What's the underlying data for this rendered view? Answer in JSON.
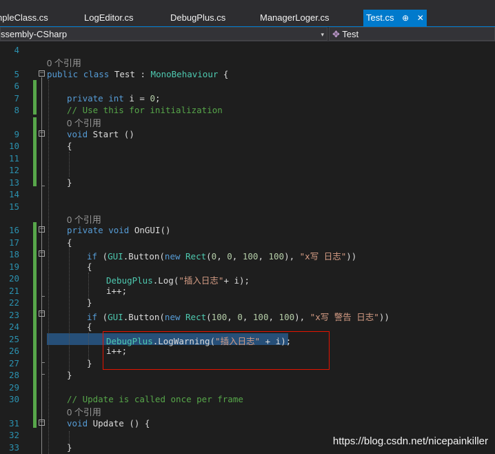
{
  "tabs": [
    {
      "label": "npleClass.cs",
      "active": false
    },
    {
      "label": "LogEditor.cs",
      "active": false
    },
    {
      "label": "DebugPlus.cs",
      "active": false
    },
    {
      "label": "ManagerLoger.cs",
      "active": false
    },
    {
      "label": "Test.cs",
      "active": true
    }
  ],
  "tab_pin_icon": "⊕",
  "tab_close_icon": "✕",
  "nav": {
    "project_combo": "ssembly-CSharp",
    "member_combo": "Test",
    "member_icon": "✥",
    "dropdown_arrow": "▾"
  },
  "references_label": "0 个引用",
  "lines": {
    "l4": "4",
    "l5": "5",
    "l6": "6",
    "l7": "7",
    "l8": "8",
    "l9": "9",
    "l10": "10",
    "l11": "11",
    "l12": "12",
    "l13": "13",
    "l14": "14",
    "l15": "15",
    "l16": "16",
    "l17": "17",
    "l18": "18",
    "l19": "19",
    "l20": "20",
    "l21": "21",
    "l22": "22",
    "l23": "23",
    "l24": "24",
    "l25": "25",
    "l26": "26",
    "l27": "27",
    "l28": "28",
    "l29": "29",
    "l30": "30",
    "l31": "31",
    "l32": "32",
    "l33": "33"
  },
  "code": {
    "c5_kw1": "public",
    "c5_kw2": "class",
    "c5_name": " Test : ",
    "c5_base": "MonoBehaviour",
    "c5_brace": " {",
    "c7_kw1": "private",
    "c7_kw2": "int",
    "c7_rest": " i = ",
    "c7_num": "0",
    "c7_semi": ";",
    "c8_comment": "// Use this for initialization",
    "c9_kw": "void",
    "c9_rest": " Start ()",
    "c10": "{",
    "c13": "}",
    "c16_kw1": "private",
    "c16_kw2": "void",
    "c16_rest": " OnGUI()",
    "c17": "{",
    "c18_if": "if",
    "c18_p1": " (",
    "c18_gui": "GUI",
    "c18_btn": ".Button(",
    "c18_new": "new",
    "c18_rect": "Rect",
    "c18_args_pre": "(",
    "c18_n1": "0",
    "c18_c1": ", ",
    "c18_n2": "0",
    "c18_c2": ", ",
    "c18_n3": "100",
    "c18_c3": ", ",
    "c18_n4": "100",
    "c18_c4": "), ",
    "c18_str": "\"x写 日志\"",
    "c18_end": "))",
    "c19": "{",
    "c20_type": "DebugPlus",
    "c20_rest": ".Log(",
    "c20_str": "\"插入日志\"",
    "c20_end": "+ i);",
    "c21": "i++;",
    "c22": "}",
    "c23_if": "if",
    "c23_p1": " (",
    "c23_gui": "GUI",
    "c23_btn": ".Button(",
    "c23_new": "new",
    "c23_rect": "Rect",
    "c23_args_pre": "(",
    "c23_n1": "100",
    "c23_c1": ", ",
    "c23_n2": "0",
    "c23_c2": ", ",
    "c23_n3": "100",
    "c23_c3": ", ",
    "c23_n4": "100",
    "c23_c4": "), ",
    "c23_str": "\"x写 警告 日志\"",
    "c23_end": "))",
    "c24": "{",
    "c25_type": "DebugPlus",
    "c25_rest": ".LogWarning(",
    "c25_str": "\"插入日志\"",
    "c25_end": " + i);",
    "c26": "i++;",
    "c27": "}",
    "c28": "}",
    "c30_comment": "// Update is called once per frame",
    "c31_kw": "void",
    "c31_rest": " Update () {",
    "c33": "}"
  },
  "watermark": "https://blog.csdn.net/nicepainkiller",
  "colors": {
    "editor_bg": "#1e1e1e",
    "keyword": "#569cd6",
    "type": "#4ec9b0",
    "string": "#d69d85",
    "comment": "#57a64a",
    "line_number": "#2b91af",
    "selection": "#264f78",
    "red_box": "#e51400",
    "active_tab": "#007acc"
  }
}
